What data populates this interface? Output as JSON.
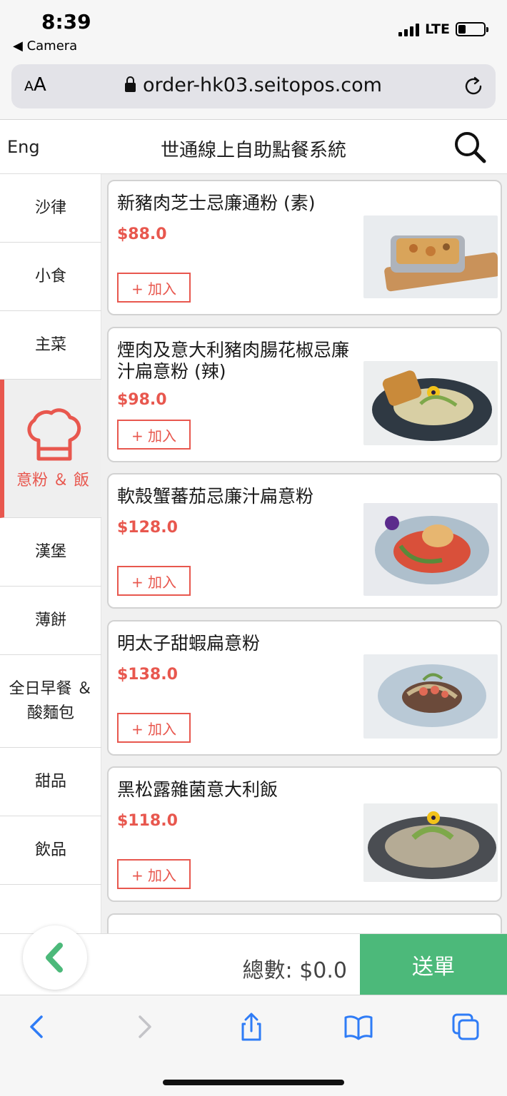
{
  "status": {
    "time": "8:39",
    "back_label": "◀ Camera",
    "network": "LTE",
    "battery_level": 0.3
  },
  "browser": {
    "aa": "AA",
    "url": "order-hk03.seitopos.com"
  },
  "header": {
    "lang": "Eng",
    "title": "世通線上自助點餐系統"
  },
  "sidebar": {
    "items": [
      {
        "label": "沙律"
      },
      {
        "label": "小食"
      },
      {
        "label": "主菜"
      },
      {
        "label": "意粉 ＆ 飯",
        "active": true,
        "icon": "chef-hat-icon"
      },
      {
        "label": "漢堡"
      },
      {
        "label": "薄餅"
      },
      {
        "label": "全日早餐 ＆ 酸麵包"
      },
      {
        "label": "甜品"
      },
      {
        "label": "飲品"
      }
    ]
  },
  "menu": {
    "add_label": "+ 加入",
    "items": [
      {
        "name": "新豬肉芝士忌廉通粉 (素)",
        "price": "$88.0"
      },
      {
        "name": "煙肉及意大利豬肉腸花椒忌廉汁扁意粉 (辣)",
        "price": "$98.0"
      },
      {
        "name": "軟殼蟹蕃茄忌廉汁扁意粉",
        "price": "$128.0"
      },
      {
        "name": "明太子甜蝦扁意粉",
        "price": "$138.0"
      },
      {
        "name": "黑松露雜菌意大利飯",
        "price": "$118.0"
      }
    ]
  },
  "order_bar": {
    "total": "總數: $0.0",
    "submit": "送單"
  },
  "colors": {
    "accent": "#e8574e",
    "submit": "#4cb97a",
    "ios_blue": "#2f7cf6"
  }
}
